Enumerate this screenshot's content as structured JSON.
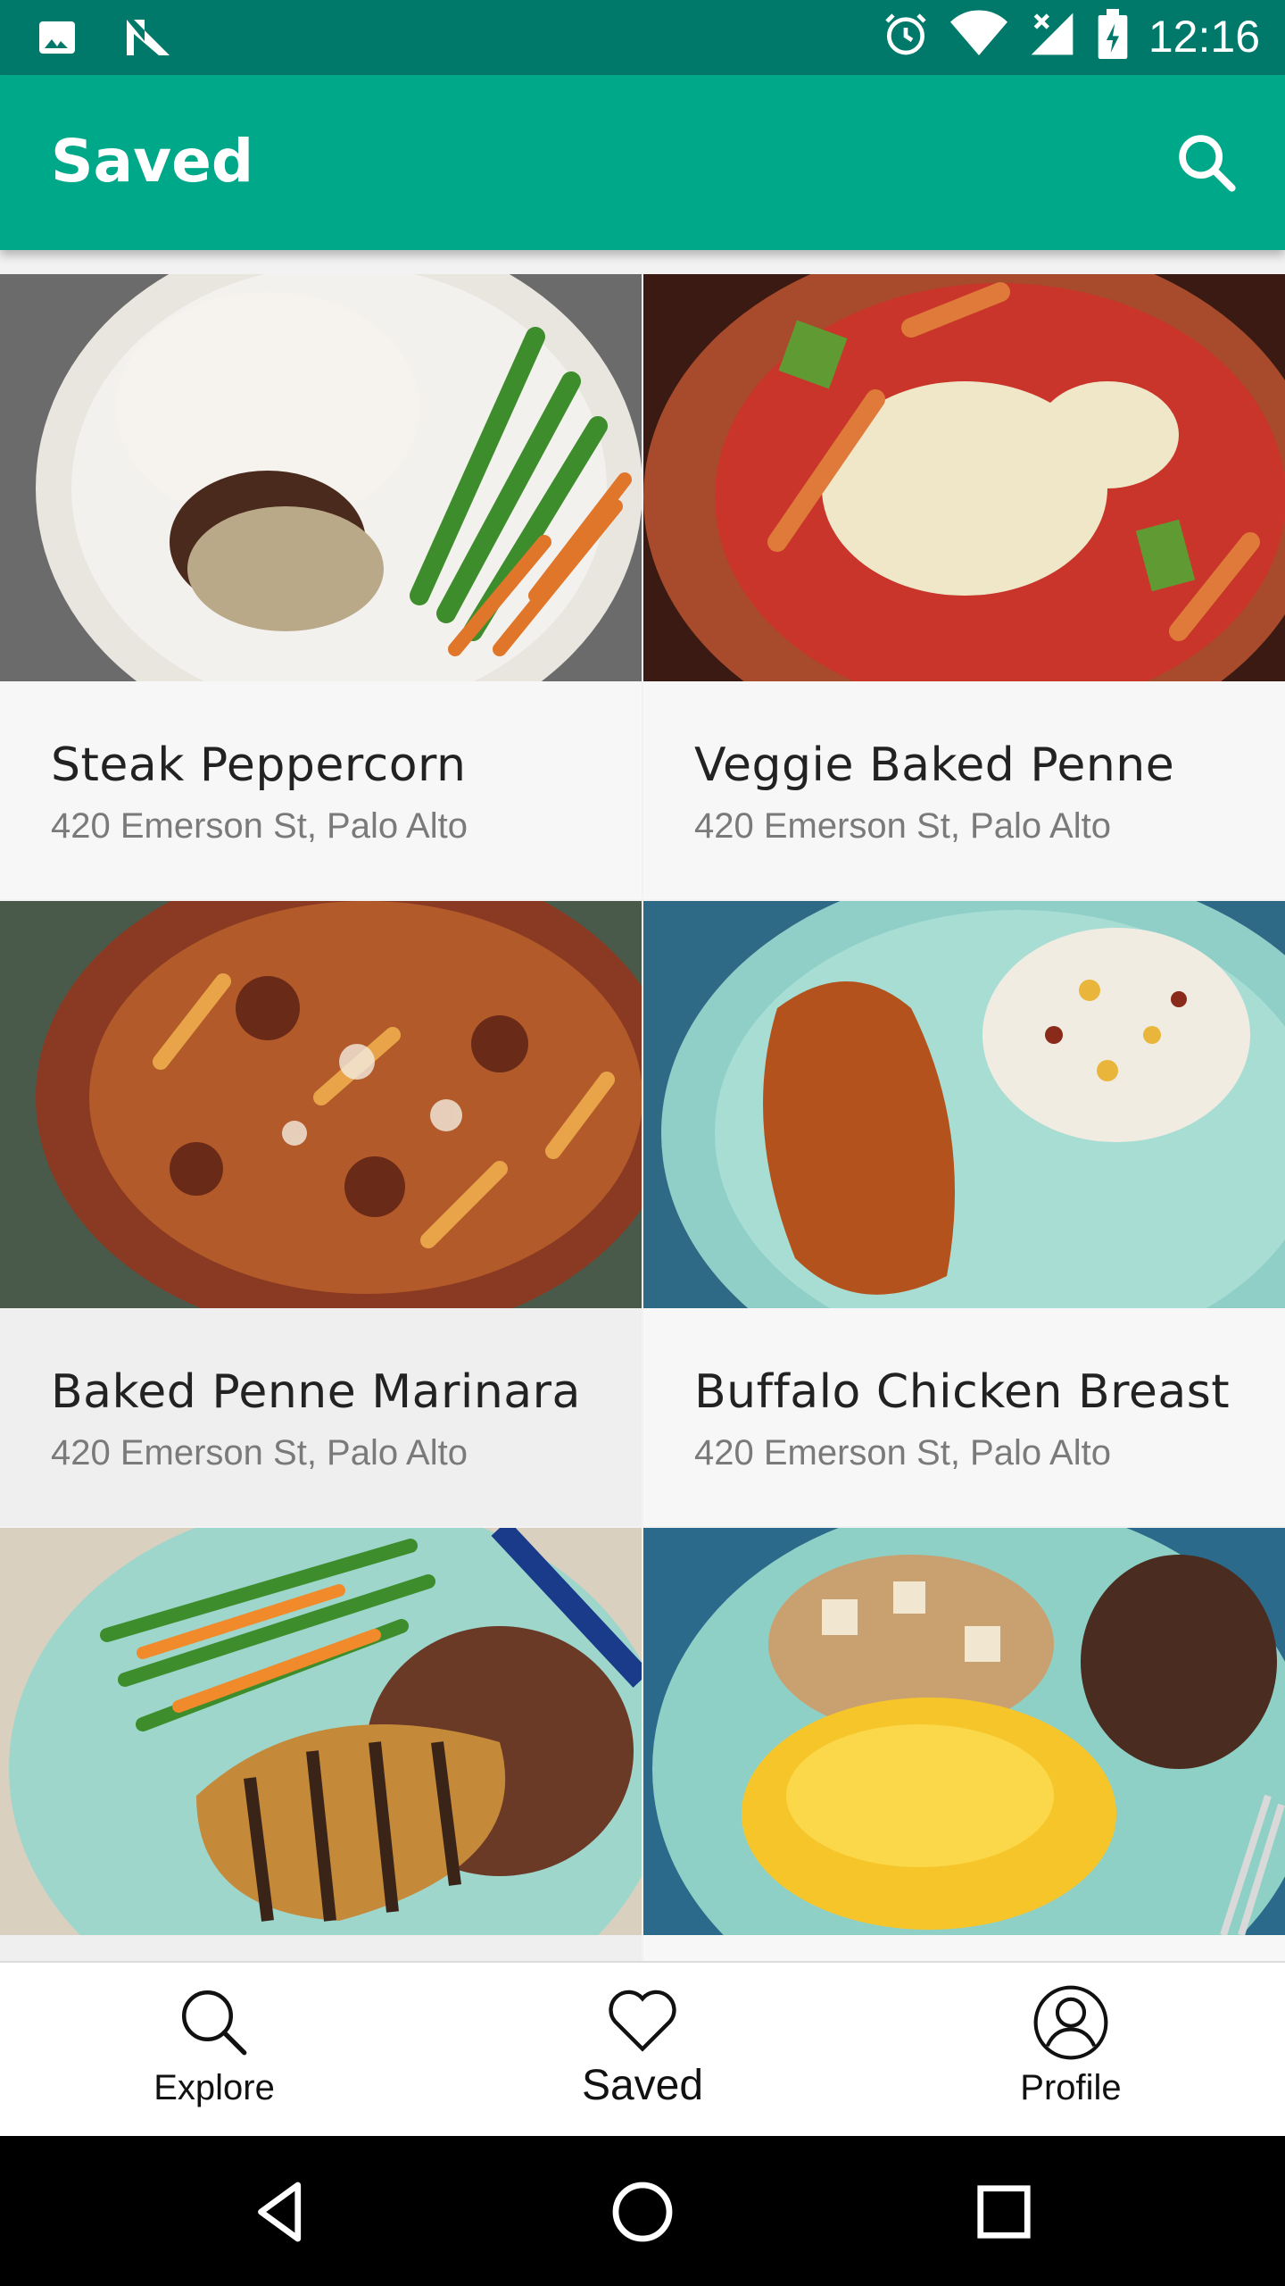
{
  "status_bar": {
    "time": "12:16",
    "left_icons": [
      "image-icon",
      "n-logo-icon"
    ],
    "right_icons": [
      "alarm-icon",
      "wifi-icon",
      "signal-icon",
      "battery-icon"
    ],
    "background": "#00796b"
  },
  "app_bar": {
    "title": "Saved",
    "action_icon": "search-icon",
    "background": "#00a88a"
  },
  "recipes": [
    {
      "name": "Steak Peppercorn",
      "address": "420 Emerson St, Palo Alto"
    },
    {
      "name": "Veggie Baked Penne",
      "address": "420 Emerson St, Palo Alto"
    },
    {
      "name": "Baked Penne Marinara",
      "address": "420 Emerson St, Palo Alto"
    },
    {
      "name": "Buffalo Chicken Breast",
      "address": "420 Emerson St, Palo Alto"
    },
    {
      "name": "",
      "address": ""
    },
    {
      "name": "",
      "address": ""
    }
  ],
  "bottom_nav": {
    "items": [
      {
        "label": "Explore",
        "icon": "search-icon"
      },
      {
        "label": "Saved",
        "icon": "heart-icon",
        "active": true
      },
      {
        "label": "Profile",
        "icon": "profile-icon"
      }
    ]
  },
  "system_nav": [
    "back-icon",
    "home-icon",
    "recents-icon"
  ]
}
